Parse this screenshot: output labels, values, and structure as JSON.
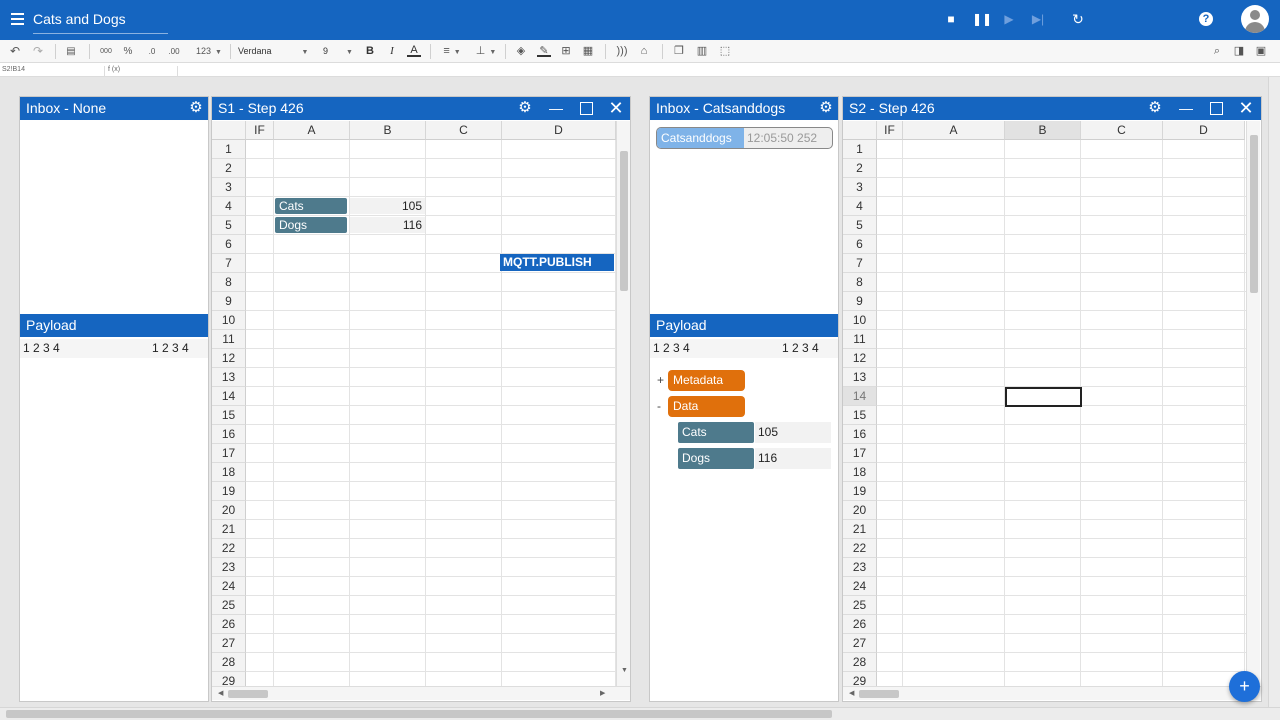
{
  "header": {
    "title": "Cats and Dogs",
    "icons": {
      "menu": "hamburger-icon",
      "stop": "stop-icon",
      "pause": "pause-icon",
      "play": "play-icon",
      "step": "skip-icon",
      "reload": "reload-icon",
      "help": "help-icon",
      "account": "account-icon"
    }
  },
  "toolbar": {
    "format_123": "123",
    "font": "Verdana",
    "size": "9",
    "bold": "B",
    "italic": "I",
    "textcolor": "A",
    "thousands": "000",
    "percent": "%"
  },
  "formula_bar": {
    "cell_ref": "S2!B14",
    "fx": "f (x)"
  },
  "left_inbox": {
    "title": "Inbox - None",
    "payload_title": "Payload",
    "payload_cols_left": "1 2 3 4",
    "payload_cols_right": "1 2 3 4"
  },
  "sheet1": {
    "title": "S1 - Step 426",
    "columns": [
      "IF",
      "A",
      "B",
      "C",
      "D"
    ],
    "rows": [
      "1",
      "2",
      "3",
      "4",
      "5",
      "6",
      "7",
      "8",
      "9",
      "10",
      "11",
      "12",
      "13",
      "14",
      "15",
      "16",
      "17",
      "18",
      "19",
      "20",
      "21",
      "22",
      "23",
      "24",
      "25",
      "26",
      "27",
      "28",
      "29"
    ],
    "cells": {
      "a4": "Cats",
      "b4": "105",
      "a5": "Dogs",
      "b5": "116",
      "d7": "MQTT.PUBLISH"
    }
  },
  "right_inbox": {
    "title": "Inbox - Catsanddogs",
    "item_label": "Catsanddogs",
    "item_time": "12:05:50 252",
    "payload_title": "Payload",
    "payload_cols_left": "1 2 3 4",
    "payload_cols_right": "1 2 3 4",
    "tree": {
      "metadata_toggle": "+",
      "metadata": "Metadata",
      "data_toggle": "-",
      "data": "Data",
      "entries": [
        {
          "key": "Cats",
          "value": "105"
        },
        {
          "key": "Dogs",
          "value": "116"
        }
      ]
    }
  },
  "sheet2": {
    "title": "S2 - Step 426",
    "columns": [
      "IF",
      "A",
      "B",
      "C",
      "D"
    ],
    "rows": [
      "1",
      "2",
      "3",
      "4",
      "5",
      "6",
      "7",
      "8",
      "9",
      "10",
      "11",
      "12",
      "13",
      "14",
      "15",
      "16",
      "17",
      "18",
      "19",
      "20",
      "21",
      "22",
      "23",
      "24",
      "25",
      "26",
      "27",
      "28",
      "29"
    ]
  },
  "fab_label": "+"
}
